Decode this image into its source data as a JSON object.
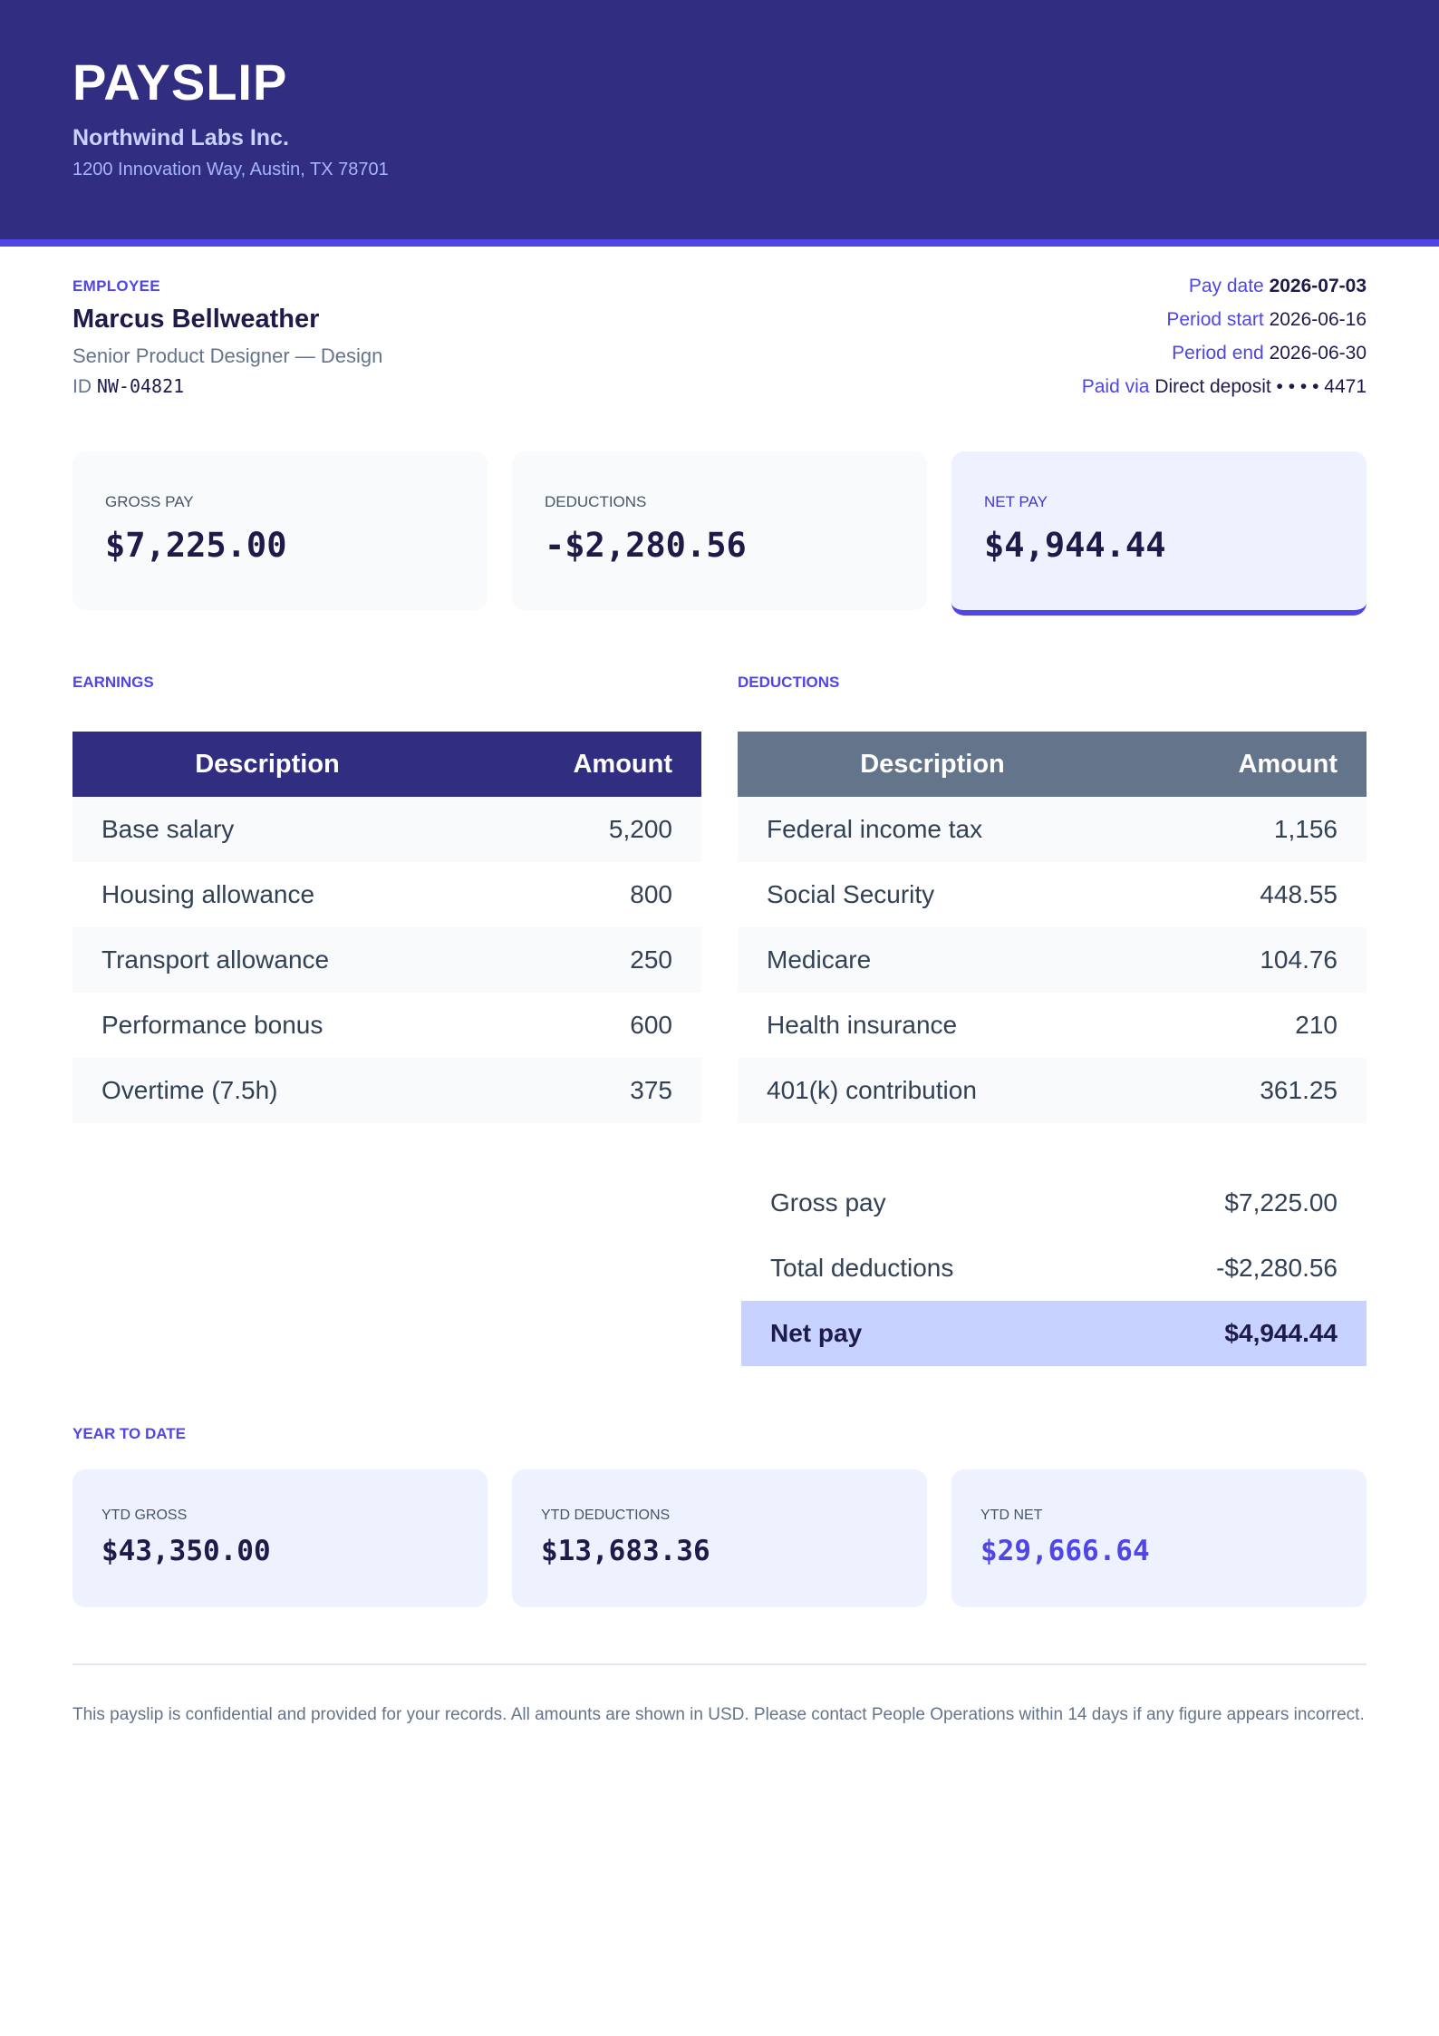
{
  "header": {
    "title": "PAYSLIP",
    "company": "Northwind Labs Inc.",
    "address": "1200 Innovation Way, Austin, TX 78701"
  },
  "employee": {
    "section_label": "EMPLOYEE",
    "name": "Marcus Bellweather",
    "role": "Senior Product Designer — Design",
    "id_label": "ID",
    "id_value": "NW-04821"
  },
  "meta": {
    "pay_date_label": "Pay date",
    "pay_date": "2026-07-03",
    "period_start_label": "Period start",
    "period_start": "2026-06-16",
    "period_end_label": "Period end",
    "period_end": "2026-06-30",
    "paid_via_label": "Paid via",
    "paid_via": "Direct deposit • • • • 4471"
  },
  "cards": {
    "gross_label": "GROSS PAY",
    "gross_value": "$7,225.00",
    "deductions_label": "DEDUCTIONS",
    "deductions_value": "-$2,280.56",
    "net_label": "NET PAY",
    "net_value": "$4,944.44"
  },
  "earnings": {
    "section_label": "EARNINGS",
    "col_desc": "Description",
    "col_amount": "Amount",
    "rows": [
      {
        "desc": "Base salary",
        "amount": "5,200"
      },
      {
        "desc": "Housing allowance",
        "amount": "800"
      },
      {
        "desc": "Transport allowance",
        "amount": "250"
      },
      {
        "desc": "Performance bonus",
        "amount": "600"
      },
      {
        "desc": "Overtime (7.5h)",
        "amount": "375"
      }
    ]
  },
  "deductions": {
    "section_label": "DEDUCTIONS",
    "col_desc": "Description",
    "col_amount": "Amount",
    "rows": [
      {
        "desc": "Federal income tax",
        "amount": "1,156"
      },
      {
        "desc": "Social Security",
        "amount": "448.55"
      },
      {
        "desc": "Medicare",
        "amount": "104.76"
      },
      {
        "desc": "Health insurance",
        "amount": "210"
      },
      {
        "desc": "401(k) contribution",
        "amount": "361.25"
      }
    ]
  },
  "summary": {
    "gross_label": "Gross pay",
    "gross_value": "$7,225.00",
    "total_ded_label": "Total deductions",
    "total_ded_value": "-$2,280.56",
    "net_label": "Net pay",
    "net_value": "$4,944.44"
  },
  "ytd": {
    "section_label": "YEAR TO DATE",
    "gross_label": "YTD GROSS",
    "gross_value": "$43,350.00",
    "deductions_label": "YTD DEDUCTIONS",
    "deductions_value": "$13,683.36",
    "net_label": "YTD NET",
    "net_value": "$29,666.64"
  },
  "footer": {
    "note": "This payslip is confidential and provided for your records. All amounts are shown in USD. Please contact People Operations within 14 days if any figure appears incorrect."
  },
  "colors": {
    "header_bg": "#312e81",
    "accent": "#4f46e5",
    "deductions_header": "#64748b",
    "net_highlight": "#c7d2fe"
  }
}
